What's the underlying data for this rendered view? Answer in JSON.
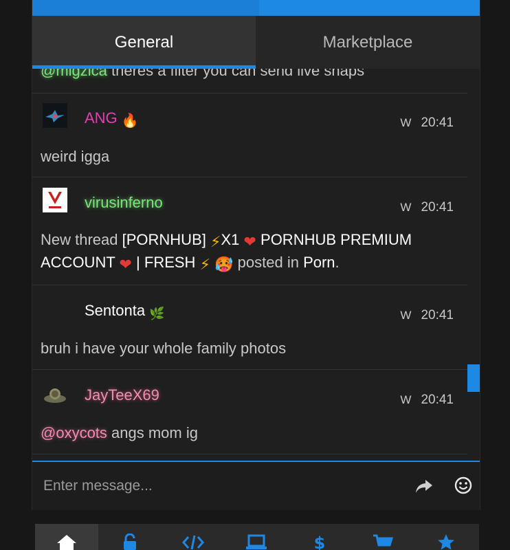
{
  "tabs": [
    {
      "label": "General",
      "active": true
    },
    {
      "label": "Marketplace",
      "active": false
    }
  ],
  "messages": [
    {
      "partial_mention": "@migzica",
      "partial_text": " theres a filter you can send live snaps"
    },
    {
      "username": "ANG",
      "badge": "🔥",
      "name_color": "#e040b0",
      "w": "W",
      "time": "20:41",
      "text": "weird igga"
    },
    {
      "username": "virusinferno",
      "name_color": "#7de37d",
      "w": "W",
      "time": "20:41",
      "text_parts": {
        "p1": "New thread ",
        "p2": "[PORNHUB] ",
        "e1": "⚡",
        "p3": "X1 ",
        "e2": "❤",
        "p4": " PORNHUB PREMIUM",
        "p5": "ACCOUNT ",
        "e3": "❤",
        "p6": " | FRESH ",
        "e4": "⚡",
        "e5": "🥵",
        "p7": " posted in ",
        "p8": "Porn",
        "p9": "."
      }
    },
    {
      "username": "Sentonta",
      "badge": "🌿",
      "name_color": "#ffffff",
      "w": "W",
      "time": "20:41",
      "text": "bruh i have your whole family photos"
    },
    {
      "username": "JayTeeX69",
      "name_color": "#f58ab3",
      "w": "W",
      "time": "20:41",
      "mention": "@oxycots",
      "text": " angs mom ig"
    }
  ],
  "input": {
    "placeholder": "Enter message..."
  },
  "nav": [
    "home-icon",
    "unlock-icon",
    "code-icon",
    "laptop-icon",
    "dollar-icon",
    "cart-icon",
    "star-icon"
  ],
  "colors": {
    "accent": "#1e88e5",
    "background": "#1f1f1f"
  }
}
